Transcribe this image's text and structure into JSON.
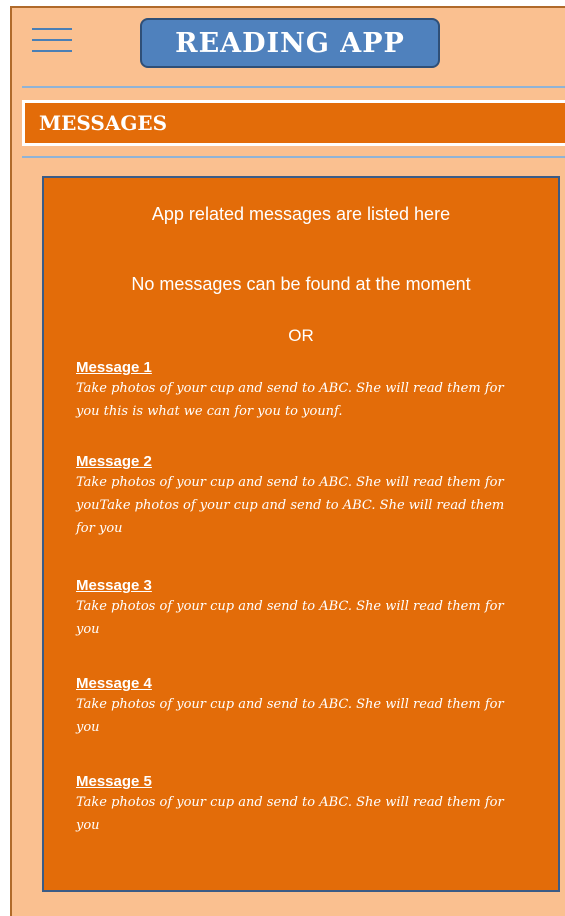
{
  "header": {
    "menu_icon": "hamburger-menu-icon",
    "app_title": "READING APP"
  },
  "section": {
    "title": "MESSAGES"
  },
  "panel": {
    "intro": "App related messages are listed here",
    "empty_state": "No messages can be found at the moment",
    "separator": "OR",
    "messages": [
      {
        "title": "Message 1",
        "body": "Take photos of your cup and send to ABC. She will read them for you this is what we can for you to younf."
      },
      {
        "title": "Message 2",
        "body": "Take photos of your cup and send to ABC. She will read them for youTake photos of your cup and send to ABC. She will read them for you"
      },
      {
        "title": "Message 3",
        "body": "Take photos of your cup and send to ABC. She will read them for you"
      },
      {
        "title": "Message 4",
        "body": "Take photos of your cup and send to ABC. She will read them for you"
      },
      {
        "title": "Message 5",
        "body": "Take photos of your cup and send to ABC. She will read them for you"
      }
    ]
  },
  "colors": {
    "background": "#fac090",
    "accent_orange": "#e36c09",
    "title_button_blue": "#4f81bd",
    "panel_border": "#3a5b86",
    "divider": "#8fb3d6"
  }
}
